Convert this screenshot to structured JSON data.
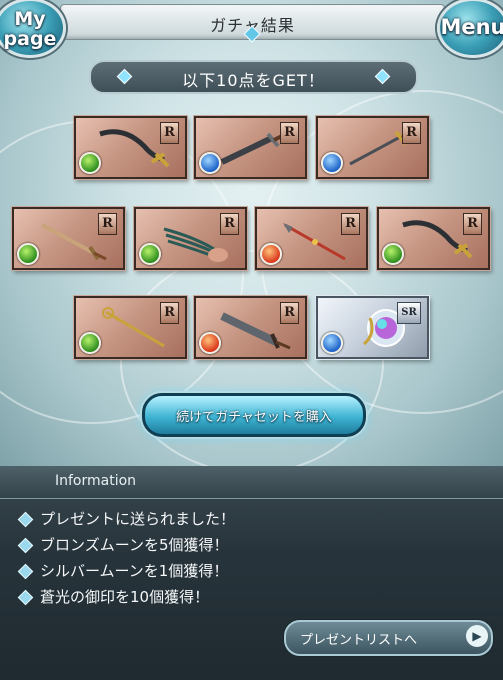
{
  "header": {
    "title": "ガチャ結果",
    "mypage_line1": "My",
    "mypage_line2": "page",
    "menu_label": "Menu"
  },
  "banner": {
    "text": "以下10点をGET！"
  },
  "items": [
    {
      "rarity": "R",
      "element": "wind",
      "weapon": "scimitar"
    },
    {
      "rarity": "R",
      "element": "water",
      "weapon": "dagger"
    },
    {
      "rarity": "R",
      "element": "water",
      "weapon": "rapier"
    },
    {
      "rarity": "R",
      "element": "wind",
      "weapon": "sword"
    },
    {
      "rarity": "R",
      "element": "wind",
      "weapon": "claw"
    },
    {
      "rarity": "R",
      "element": "fire",
      "weapon": "spear"
    },
    {
      "rarity": "R",
      "element": "wind",
      "weapon": "scimitar"
    },
    {
      "rarity": "R",
      "element": "wind",
      "weapon": "staff"
    },
    {
      "rarity": "R",
      "element": "fire",
      "weapon": "greatsword"
    },
    {
      "rarity": "SR",
      "element": "water",
      "weapon": "orb"
    }
  ],
  "continue_button": {
    "label": "続けてガチャセットを購入"
  },
  "information": {
    "title": "Information",
    "lines": [
      "プレゼントに送られました！",
      "ブロンズムーンを5個獲得！",
      "シルバームーンを1個獲得！",
      "蒼光の御印を10個獲得！"
    ]
  },
  "present_button": {
    "label": "プレゼントリストへ",
    "arrow_icon": "arrow-right-icon"
  }
}
